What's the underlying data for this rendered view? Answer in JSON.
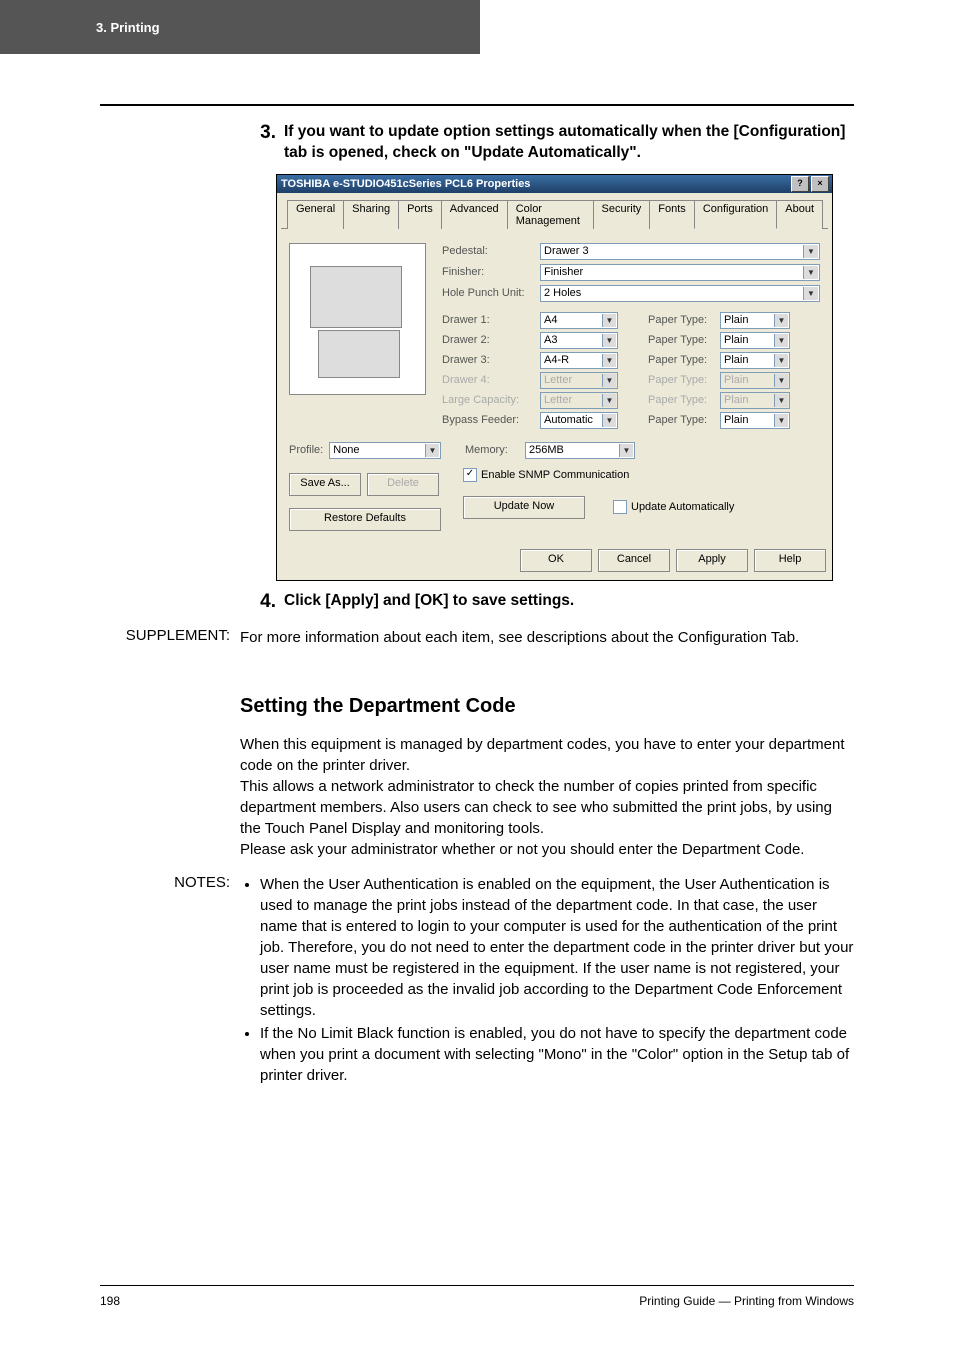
{
  "header_band": "3.  Printing",
  "step3": {
    "num": "3.",
    "text": "If you want to update option settings automatically when the [Configuration] tab is opened, check on \"Update Automatically\"."
  },
  "dialog": {
    "title": "TOSHIBA e-STUDIO451cSeries PCL6 Properties",
    "help_btn": "?",
    "close_btn": "×",
    "tabs": [
      "General",
      "Sharing",
      "Ports",
      "Advanced",
      "Color Management",
      "Security",
      "Fonts",
      "Configuration",
      "About"
    ],
    "active_tab_index": 7,
    "top_fields": [
      {
        "label": "Pedestal:",
        "value": "Drawer 3"
      },
      {
        "label": "Finisher:",
        "value": "Finisher"
      },
      {
        "label": "Hole Punch Unit:",
        "value": "2 Holes"
      }
    ],
    "drawers": [
      {
        "label": "Drawer 1:",
        "size": "A4",
        "ptype_label": "Paper Type:",
        "ptype": "Plain",
        "disabled": false
      },
      {
        "label": "Drawer 2:",
        "size": "A3",
        "ptype_label": "Paper Type:",
        "ptype": "Plain",
        "disabled": false
      },
      {
        "label": "Drawer 3:",
        "size": "A4-R",
        "ptype_label": "Paper Type:",
        "ptype": "Plain",
        "disabled": false
      },
      {
        "label": "Drawer 4:",
        "size": "Letter",
        "ptype_label": "Paper Type:",
        "ptype": "Plain",
        "disabled": true
      },
      {
        "label": "Large Capacity:",
        "size": "Letter",
        "ptype_label": "Paper Type:",
        "ptype": "Plain",
        "disabled": true
      },
      {
        "label": "Bypass Feeder:",
        "size": "Automatic",
        "ptype_label": "Paper Type:",
        "ptype": "Plain",
        "disabled": false
      }
    ],
    "profile_label": "Profile:",
    "profile_value": "None",
    "memory_label": "Memory:",
    "memory_value": "256MB",
    "save_as": "Save As...",
    "delete": "Delete",
    "enable_snmp": "Enable SNMP Communication",
    "restore_defaults": "Restore Defaults",
    "update_now": "Update Now",
    "update_auto": "Update Automatically",
    "ok": "OK",
    "cancel": "Cancel",
    "apply": "Apply",
    "help": "Help"
  },
  "step4": {
    "num": "4.",
    "text": "Click [Apply] and [OK] to save settings."
  },
  "supplement": {
    "label": "SUPPLEMENT:",
    "text": "For more information about each item, see descriptions about the Configuration Tab."
  },
  "section_heading": "Setting the Department Code",
  "section_para": "When this equipment is managed by department codes, you have to enter your department code on the printer driver.\nThis allows a network administrator to check the number of copies printed from specific department members.  Also users can check to see who submitted the print jobs, by using the Touch Panel Display and monitoring tools.\nPlease ask your administrator whether or not you should enter the Department Code.",
  "notes": {
    "label": "NOTES:",
    "items": [
      "When the User Authentication is enabled on the equipment, the User Authentication is used to manage the print jobs instead of the department code.  In that case, the user name that is entered to login to your computer is used for the authentication of the print job. Therefore, you do not need to enter the department code in the printer driver but your user name must be registered in the equipment. If the user name is not registered, your print job is proceeded as the invalid job according to the Department Code Enforcement settings.",
      "If the No Limit Black function is enabled, you do not have to specify the department code when you print a document with selecting \"Mono\" in the \"Color\" option in the Setup tab of printer driver."
    ]
  },
  "footer": {
    "page": "198",
    "right": "Printing Guide — Printing from Windows"
  }
}
